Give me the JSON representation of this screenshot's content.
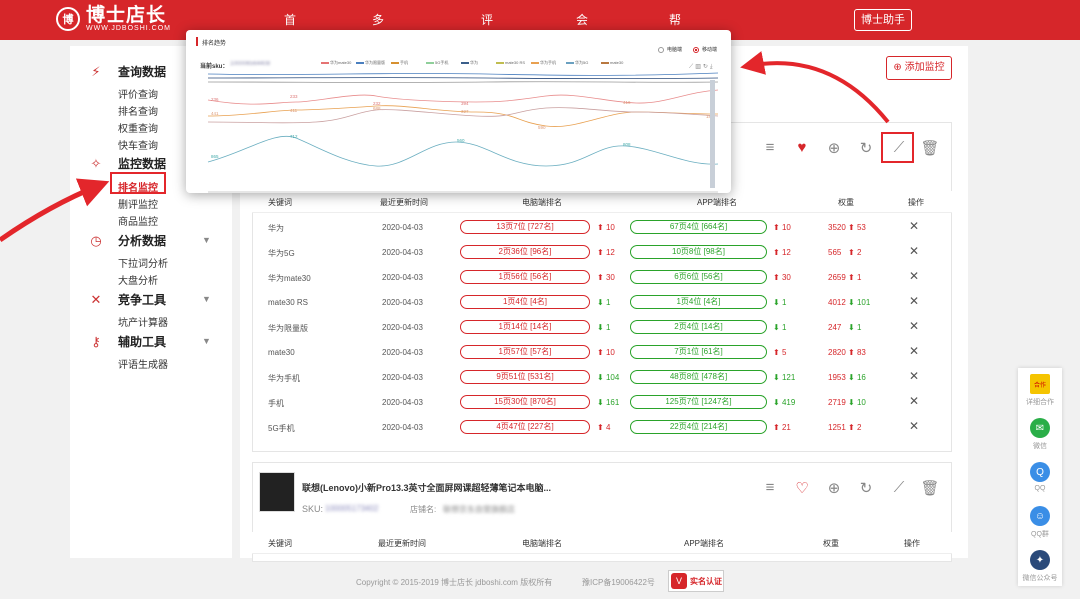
{
  "header": {
    "logo_mark": "博",
    "logo_name": "博士店长",
    "logo_url": "WWW.JDBOSHI.COM",
    "nav": [
      "首页",
      "多维监控",
      "评价分析",
      "会员服务",
      "帮助与反馈"
    ],
    "helper_button": "博士助手"
  },
  "sidebar": {
    "sections": [
      {
        "title": "查询数据",
        "icon": "chart-icon",
        "items": [
          "评价查询",
          "排名查询",
          "权重查询",
          "快车查询"
        ]
      },
      {
        "title": "监控数据",
        "icon": "monitor-icon",
        "items": [
          "排名监控",
          "删评监控",
          "商品监控"
        ]
      },
      {
        "title": "分析数据",
        "icon": "analysis-icon",
        "items": [
          "下拉词分析",
          "大盘分析"
        ]
      },
      {
        "title": "竞争工具",
        "icon": "tools-icon",
        "items": [
          "坑产计算器"
        ]
      },
      {
        "title": "辅助工具",
        "icon": "key-icon",
        "items": [
          "评语生成器"
        ]
      }
    ]
  },
  "main": {
    "add_monitor_label": "添加监控",
    "table_headers": [
      "关键词",
      "最近更新时间",
      "电脑端排名",
      "APP端排名",
      "权重",
      "操作"
    ],
    "rows": [
      {
        "kw": "华为",
        "date": "2020-04-03",
        "pc": "13页7位 [727名]",
        "pc_d": "10",
        "pc_up": true,
        "app": "67页4位 [664名]",
        "app_d": "10",
        "app_up": true,
        "w": "3520",
        "w_d": "53",
        "w_up": true
      },
      {
        "kw": "华为5G",
        "date": "2020-04-03",
        "pc": "2页36位 [96名]",
        "pc_d": "12",
        "pc_up": true,
        "app": "10页8位 [98名]",
        "app_d": "12",
        "app_up": true,
        "w": "565",
        "w_d": "2",
        "w_up": true
      },
      {
        "kw": "华为mate30",
        "date": "2020-04-03",
        "pc": "1页56位 [56名]",
        "pc_d": "30",
        "pc_up": true,
        "app": "6页6位 [56名]",
        "app_d": "30",
        "app_up": true,
        "w": "2659",
        "w_d": "1",
        "w_up": true
      },
      {
        "kw": "mate30 RS",
        "date": "2020-04-03",
        "pc": "1页4位 [4名]",
        "pc_d": "1",
        "pc_up": false,
        "app": "1页4位 [4名]",
        "app_d": "1",
        "app_up": false,
        "w": "4012",
        "w_d": "101",
        "w_up": false
      },
      {
        "kw": "华为限量版",
        "date": "2020-04-03",
        "pc": "1页14位 [14名]",
        "pc_d": "1",
        "pc_up": false,
        "app": "2页4位 [14名]",
        "app_d": "1",
        "app_up": false,
        "w": "247",
        "w_d": "1",
        "w_up": false
      },
      {
        "kw": "mate30",
        "date": "2020-04-03",
        "pc": "1页57位 [57名]",
        "pc_d": "10",
        "pc_up": true,
        "app": "7页1位 [61名]",
        "app_d": "5",
        "app_up": true,
        "w": "2820",
        "w_d": "83",
        "w_up": true
      },
      {
        "kw": "华为手机",
        "date": "2020-04-03",
        "pc": "9页51位 [531名]",
        "pc_d": "104",
        "pc_up": false,
        "app": "48页8位 [478名]",
        "app_d": "121",
        "app_up": false,
        "w": "1953",
        "w_d": "16",
        "w_up": false
      },
      {
        "kw": "手机",
        "date": "2020-04-03",
        "pc": "15页30位 [870名]",
        "pc_d": "161",
        "pc_up": false,
        "app": "125页7位 [1247名]",
        "app_d": "419",
        "app_up": false,
        "w": "2719",
        "w_d": "10",
        "w_up": false
      },
      {
        "kw": "5G手机",
        "date": "2020-04-03",
        "pc": "4页47位 [227名]",
        "pc_d": "4",
        "pc_up": true,
        "app": "22页4位 [214名]",
        "app_d": "21",
        "app_up": true,
        "w": "1251",
        "w_d": "2",
        "w_up": true
      }
    ],
    "product2": {
      "title": "联想(Lenovo)小新Pro13.3英寸全面屏网课超轻薄笔记本电脑...",
      "sku_label": "SKU:",
      "sku_value": "100005173402",
      "shop_label": "店铺名:",
      "shop_value": "联想京东自营旗舰店"
    }
  },
  "popup": {
    "title": "排名趋势",
    "radio_pc": "电脑端",
    "radio_app": "移动端",
    "sku_label": "当前sku：",
    "sku_value": "100006564408",
    "legend": [
      "华为mate30",
      "华为限量版",
      "手机",
      "5G手机",
      "华为",
      "mate30 RS",
      "华为手机",
      "华为5G",
      "mate30"
    ],
    "x_labels": [
      "03-28",
      "03-29",
      "03-30",
      "03-31",
      "04-01",
      "04-02",
      "04-03"
    ],
    "point_labels": [
      "236",
      "233",
      "232",
      "441",
      "411",
      "688",
      "394",
      "327",
      "590",
      "416",
      "712",
      "560",
      "808",
      "865",
      "185"
    ]
  },
  "footer": {
    "copyright": "Copyright © 2015-2019 博士店长 jdboshi.com 版权所有",
    "icp": "豫ICP备19006422号",
    "badge": "实名认证"
  },
  "floating": [
    "详细合作",
    "微信",
    "QQ",
    "QQ群",
    "微信公众号"
  ],
  "colors": {
    "brand": "#d6262a",
    "up": "#d6262a",
    "down": "#2aa32a"
  }
}
